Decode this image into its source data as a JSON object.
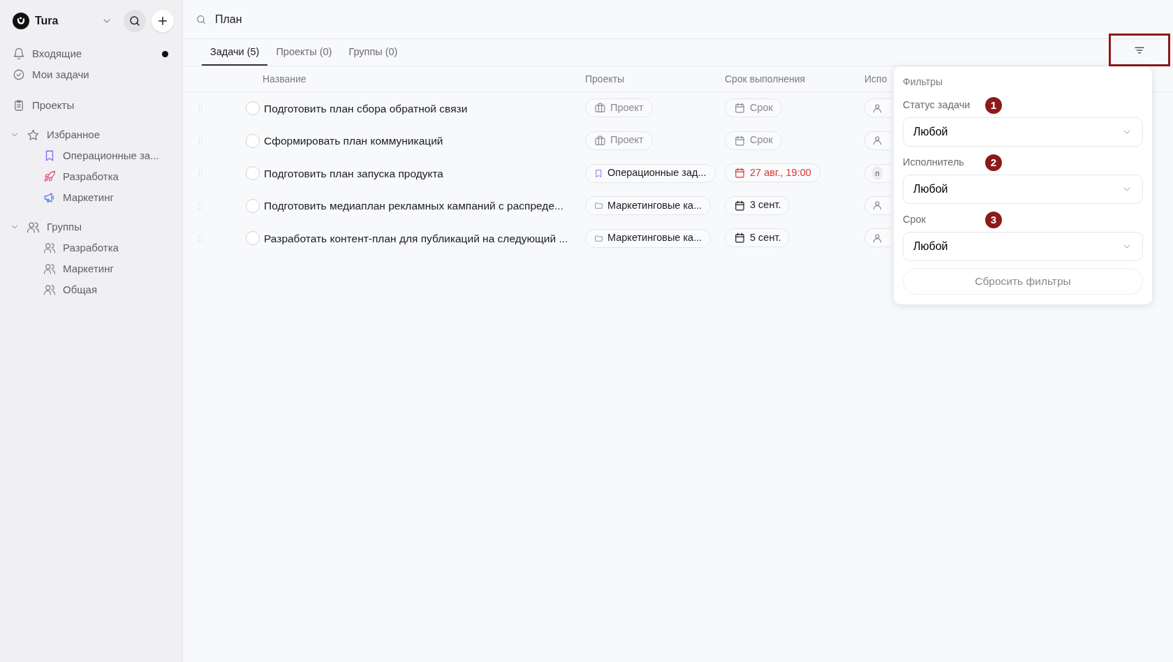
{
  "workspace": {
    "name": "Tura"
  },
  "sidebar": {
    "nav": [
      {
        "label": "Входящие",
        "unread": true
      },
      {
        "label": "Мои задачи",
        "unread": false
      },
      {
        "label": "Проекты",
        "unread": false
      }
    ],
    "sections": [
      {
        "label": "Избранное",
        "expanded": true,
        "items": [
          {
            "label": "Операционные за...",
            "color": "#8b5cf6"
          },
          {
            "label": "Разработка",
            "color": "#e64980"
          },
          {
            "label": "Маркетинг",
            "color": "#4c7ef3"
          }
        ]
      },
      {
        "label": "Группы",
        "expanded": true,
        "items": [
          {
            "label": "Разработка"
          },
          {
            "label": "Маркетинг"
          },
          {
            "label": "Общая"
          }
        ]
      }
    ]
  },
  "search": {
    "value": "План"
  },
  "tabs": [
    {
      "label": "Задачи (5)",
      "selected": true
    },
    {
      "label": "Проекты (0)",
      "selected": false
    },
    {
      "label": "Группы (0)",
      "selected": false
    }
  ],
  "filter_button": {
    "highlighted": true
  },
  "table": {
    "columns": [
      "Название",
      "Проекты",
      "Срок выполнения",
      "Испо"
    ],
    "rows": [
      {
        "title": "Подготовить план сбора обратной связи",
        "completed": false,
        "project": {
          "kind": "empty",
          "label": "Проект"
        },
        "due": {
          "kind": "empty",
          "label": "Срок"
        },
        "assignee": {
          "kind": "empty"
        }
      },
      {
        "title": "Сформировать план коммуникаций",
        "completed": false,
        "project": {
          "kind": "empty",
          "label": "Проект"
        },
        "due": {
          "kind": "empty",
          "label": "Срок"
        },
        "assignee": {
          "kind": "empty"
        }
      },
      {
        "title": "Подготовить план запуска продукта",
        "completed": false,
        "project": {
          "kind": "bookmark",
          "label": "Операционные зад..."
        },
        "due": {
          "kind": "overdue",
          "label": "27 авг., 19:00"
        },
        "assignee": {
          "kind": "initial",
          "label": "п"
        }
      },
      {
        "title": "Подготовить медиаплан рекламных кампаний с распреде...",
        "completed": false,
        "project": {
          "kind": "folder",
          "label": "Маркетинговые ка..."
        },
        "due": {
          "kind": "date",
          "label": "3 сент."
        },
        "assignee": {
          "kind": "empty"
        }
      },
      {
        "title": "Разработать контент-план для публикаций на следующий ...",
        "completed": false,
        "project": {
          "kind": "folder",
          "label": "Маркетинговые ка..."
        },
        "due": {
          "kind": "date",
          "label": "5 сент."
        },
        "assignee": {
          "kind": "empty"
        }
      }
    ]
  },
  "filters": {
    "title": "Фильтры",
    "fields": [
      {
        "label": "Статус задачи",
        "value": "Любой",
        "marker": "1"
      },
      {
        "label": "Исполнитель",
        "value": "Любой",
        "marker": "2"
      },
      {
        "label": "Срок",
        "value": "Любой",
        "marker": "3"
      }
    ],
    "reset": "Сбросить фильтры"
  }
}
